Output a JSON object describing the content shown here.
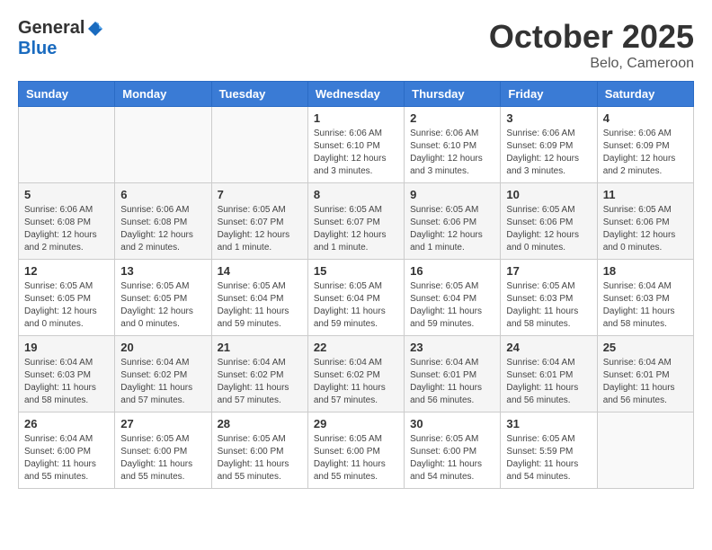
{
  "logo": {
    "general": "General",
    "blue": "Blue"
  },
  "title": "October 2025",
  "subtitle": "Belo, Cameroon",
  "days_of_week": [
    "Sunday",
    "Monday",
    "Tuesday",
    "Wednesday",
    "Thursday",
    "Friday",
    "Saturday"
  ],
  "weeks": [
    [
      {
        "day": "",
        "info": ""
      },
      {
        "day": "",
        "info": ""
      },
      {
        "day": "",
        "info": ""
      },
      {
        "day": "1",
        "info": "Sunrise: 6:06 AM\nSunset: 6:10 PM\nDaylight: 12 hours\nand 3 minutes."
      },
      {
        "day": "2",
        "info": "Sunrise: 6:06 AM\nSunset: 6:10 PM\nDaylight: 12 hours\nand 3 minutes."
      },
      {
        "day": "3",
        "info": "Sunrise: 6:06 AM\nSunset: 6:09 PM\nDaylight: 12 hours\nand 3 minutes."
      },
      {
        "day": "4",
        "info": "Sunrise: 6:06 AM\nSunset: 6:09 PM\nDaylight: 12 hours\nand 2 minutes."
      }
    ],
    [
      {
        "day": "5",
        "info": "Sunrise: 6:06 AM\nSunset: 6:08 PM\nDaylight: 12 hours\nand 2 minutes."
      },
      {
        "day": "6",
        "info": "Sunrise: 6:06 AM\nSunset: 6:08 PM\nDaylight: 12 hours\nand 2 minutes."
      },
      {
        "day": "7",
        "info": "Sunrise: 6:05 AM\nSunset: 6:07 PM\nDaylight: 12 hours\nand 1 minute."
      },
      {
        "day": "8",
        "info": "Sunrise: 6:05 AM\nSunset: 6:07 PM\nDaylight: 12 hours\nand 1 minute."
      },
      {
        "day": "9",
        "info": "Sunrise: 6:05 AM\nSunset: 6:06 PM\nDaylight: 12 hours\nand 1 minute."
      },
      {
        "day": "10",
        "info": "Sunrise: 6:05 AM\nSunset: 6:06 PM\nDaylight: 12 hours\nand 0 minutes."
      },
      {
        "day": "11",
        "info": "Sunrise: 6:05 AM\nSunset: 6:06 PM\nDaylight: 12 hours\nand 0 minutes."
      }
    ],
    [
      {
        "day": "12",
        "info": "Sunrise: 6:05 AM\nSunset: 6:05 PM\nDaylight: 12 hours\nand 0 minutes."
      },
      {
        "day": "13",
        "info": "Sunrise: 6:05 AM\nSunset: 6:05 PM\nDaylight: 12 hours\nand 0 minutes."
      },
      {
        "day": "14",
        "info": "Sunrise: 6:05 AM\nSunset: 6:04 PM\nDaylight: 11 hours\nand 59 minutes."
      },
      {
        "day": "15",
        "info": "Sunrise: 6:05 AM\nSunset: 6:04 PM\nDaylight: 11 hours\nand 59 minutes."
      },
      {
        "day": "16",
        "info": "Sunrise: 6:05 AM\nSunset: 6:04 PM\nDaylight: 11 hours\nand 59 minutes."
      },
      {
        "day": "17",
        "info": "Sunrise: 6:05 AM\nSunset: 6:03 PM\nDaylight: 11 hours\nand 58 minutes."
      },
      {
        "day": "18",
        "info": "Sunrise: 6:04 AM\nSunset: 6:03 PM\nDaylight: 11 hours\nand 58 minutes."
      }
    ],
    [
      {
        "day": "19",
        "info": "Sunrise: 6:04 AM\nSunset: 6:03 PM\nDaylight: 11 hours\nand 58 minutes."
      },
      {
        "day": "20",
        "info": "Sunrise: 6:04 AM\nSunset: 6:02 PM\nDaylight: 11 hours\nand 57 minutes."
      },
      {
        "day": "21",
        "info": "Sunrise: 6:04 AM\nSunset: 6:02 PM\nDaylight: 11 hours\nand 57 minutes."
      },
      {
        "day": "22",
        "info": "Sunrise: 6:04 AM\nSunset: 6:02 PM\nDaylight: 11 hours\nand 57 minutes."
      },
      {
        "day": "23",
        "info": "Sunrise: 6:04 AM\nSunset: 6:01 PM\nDaylight: 11 hours\nand 56 minutes."
      },
      {
        "day": "24",
        "info": "Sunrise: 6:04 AM\nSunset: 6:01 PM\nDaylight: 11 hours\nand 56 minutes."
      },
      {
        "day": "25",
        "info": "Sunrise: 6:04 AM\nSunset: 6:01 PM\nDaylight: 11 hours\nand 56 minutes."
      }
    ],
    [
      {
        "day": "26",
        "info": "Sunrise: 6:04 AM\nSunset: 6:00 PM\nDaylight: 11 hours\nand 55 minutes."
      },
      {
        "day": "27",
        "info": "Sunrise: 6:05 AM\nSunset: 6:00 PM\nDaylight: 11 hours\nand 55 minutes."
      },
      {
        "day": "28",
        "info": "Sunrise: 6:05 AM\nSunset: 6:00 PM\nDaylight: 11 hours\nand 55 minutes."
      },
      {
        "day": "29",
        "info": "Sunrise: 6:05 AM\nSunset: 6:00 PM\nDaylight: 11 hours\nand 55 minutes."
      },
      {
        "day": "30",
        "info": "Sunrise: 6:05 AM\nSunset: 6:00 PM\nDaylight: 11 hours\nand 54 minutes."
      },
      {
        "day": "31",
        "info": "Sunrise: 6:05 AM\nSunset: 5:59 PM\nDaylight: 11 hours\nand 54 minutes."
      },
      {
        "day": "",
        "info": ""
      }
    ]
  ]
}
